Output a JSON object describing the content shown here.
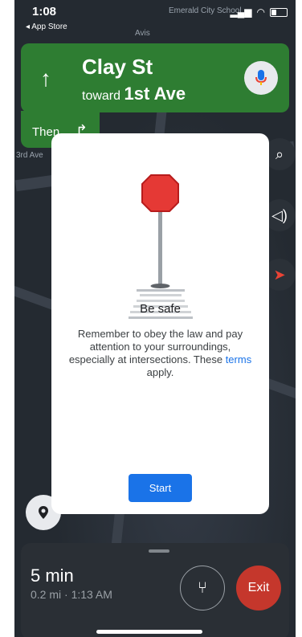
{
  "status_bar": {
    "time": "1:08",
    "back_app": "App Store"
  },
  "map_labels": {
    "school": "Emerald City School",
    "avis": "Avis",
    "third_ave": "3rd Ave"
  },
  "navigation": {
    "street": "Clay St",
    "toward_prefix": "toward",
    "toward_street": "1st Ave",
    "then_label": "Then",
    "mic_icon": "mic-icon"
  },
  "dialog": {
    "title": "Be safe",
    "body_text": "Remember to obey the law and pay attention to your surroundings, especially at intersections. These",
    "terms_link": "terms",
    "body_suffix": "apply.",
    "start_button": "Start"
  },
  "trip": {
    "eta": "5 min",
    "details": "0.2 mi · 1:13 AM",
    "exit_button": "Exit"
  },
  "colors": {
    "nav_green": "#2e7d32",
    "primary_blue": "#1a73e8",
    "exit_red": "#c5372c"
  }
}
